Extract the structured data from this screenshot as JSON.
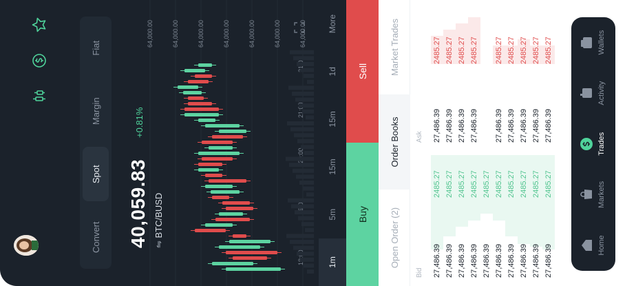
{
  "tabs": {
    "items": [
      "Convert",
      "Spot",
      "Margin",
      "Fiat"
    ],
    "active_index": 1
  },
  "ticker": {
    "price": "40,059.83",
    "change": "+0.81%",
    "pair": "BTC/BUSD"
  },
  "chart": {
    "price_labels": [
      "64,000.00",
      "64,000.00",
      "64,000.00",
      "64,000.00",
      "64,000.00",
      "64,000.00",
      "64,000.00"
    ],
    "time_labels": [
      "18:00",
      "19:00",
      "20:00",
      "21:00",
      "21:00"
    ],
    "colors": {
      "up": "#5dd3a1",
      "down": "#e04c4c"
    }
  },
  "timeframes": {
    "items": [
      "1m",
      "5m",
      "15m",
      "15m",
      "1d",
      "More"
    ],
    "active_index": 0
  },
  "actions": {
    "buy": "Buy",
    "sell": "Sell"
  },
  "orderbook": {
    "tabs": [
      "Open Order (2)",
      "Order Books",
      "Market Trades"
    ],
    "active_tab": 1,
    "columns": {
      "bid": "Bid",
      "ask": "Ask"
    },
    "rows": [
      {
        "bid_price": "27,486.39",
        "bid_amount": "2485.27",
        "ask_price": "27,486.39",
        "ask_amount": "2485.27"
      },
      {
        "bid_price": "27,486.39",
        "bid_amount": "2485.27",
        "ask_price": "27,486.39",
        "ask_amount": "2485.27"
      },
      {
        "bid_price": "27,486.39",
        "bid_amount": "2485.27",
        "ask_price": "27,486.39",
        "ask_amount": "2485.27"
      },
      {
        "bid_price": "27,486.39",
        "bid_amount": "2485.27",
        "ask_price": "27,486.39",
        "ask_amount": "2485.27"
      },
      {
        "bid_price": "27,486.39",
        "bid_amount": "2485.27",
        "ask_price": "",
        "ask_amount": ""
      },
      {
        "bid_price": "27,486.39",
        "bid_amount": "2485.27",
        "ask_price": "27,486.39",
        "ask_amount": "2485.27"
      },
      {
        "bid_price": "27,486.39",
        "bid_amount": "2485.27",
        "ask_price": "27,486.39",
        "ask_amount": "2485.27"
      },
      {
        "bid_price": "27,486.39",
        "bid_amount": "2485.27",
        "ask_price": "27,486.39",
        "ask_amount": "2485.27"
      },
      {
        "bid_price": "27,486.39",
        "bid_amount": "2485.27",
        "ask_price": "27,486.39",
        "ask_amount": "2485.27"
      },
      {
        "bid_price": "27,486.39",
        "bid_amount": "2485.27",
        "ask_price": "27,486.39",
        "ask_amount": "2485.27"
      }
    ],
    "bid_depth": [
      0.72,
      0.62,
      0.55,
      0.5,
      0.45,
      0.5,
      0.62,
      0.68,
      0.7,
      0.72
    ],
    "ask_depth": [
      0.45,
      0.55,
      0.65,
      0.75,
      0.4,
      0.3,
      0.3,
      0.4,
      0.3,
      0.3
    ]
  },
  "nav": {
    "items": [
      "Home",
      "Markets",
      "Trades",
      "Activity",
      "Wallets"
    ],
    "icons": [
      "home-icon",
      "markets-icon",
      "trades-icon",
      "activity-icon",
      "wallets-icon"
    ],
    "active_index": 2
  }
}
